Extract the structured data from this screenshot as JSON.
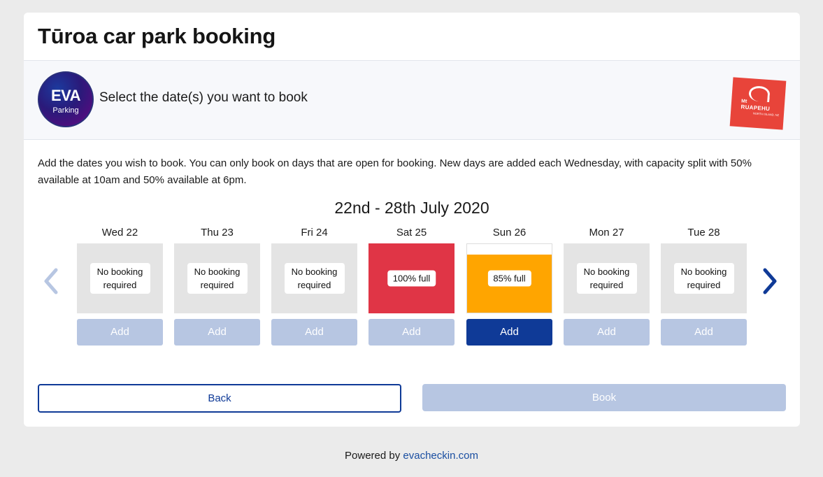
{
  "card": {
    "title": "Tūroa car park booking"
  },
  "band": {
    "eva_logo": {
      "main": "EVA",
      "sub": "Parking"
    },
    "instruction": "Select the date(s) you want to book",
    "ruapehu_logo": {
      "mt": "Mt",
      "name": "RUAPEHU",
      "location": "NORTH ISLAND, NZ"
    }
  },
  "intro": "Add the dates you wish to book. You can only book on days that are open for booking. New days are added each Wednesday, with capacity split with 50% available at 10am and 50% available at 6pm.",
  "week": {
    "title": "22nd - 28th July 2020",
    "days": [
      {
        "label": "Wed 22",
        "status": "No booking required",
        "add_label": "Add"
      },
      {
        "label": "Thu 23",
        "status": "No booking required",
        "add_label": "Add"
      },
      {
        "label": "Fri 24",
        "status": "No booking required",
        "add_label": "Add"
      },
      {
        "label": "Sat 25",
        "status": "100% full",
        "fill_percent": 100,
        "add_label": "Add"
      },
      {
        "label": "Sun 26",
        "status": "85% full",
        "fill_percent": 85,
        "add_label": "Add"
      },
      {
        "label": "Mon 27",
        "status": "No booking required",
        "add_label": "Add"
      },
      {
        "label": "Tue 28",
        "status": "No booking required",
        "add_label": "Add"
      }
    ]
  },
  "actions": {
    "back_label": "Back",
    "book_label": "Book"
  },
  "footer": {
    "prefix": "Powered by ",
    "link": "evacheckin.com"
  },
  "colors": {
    "primary": "#0f3a97",
    "disabled": "#b7c6e2",
    "full": "#e03546",
    "partial": "#ffa500"
  }
}
